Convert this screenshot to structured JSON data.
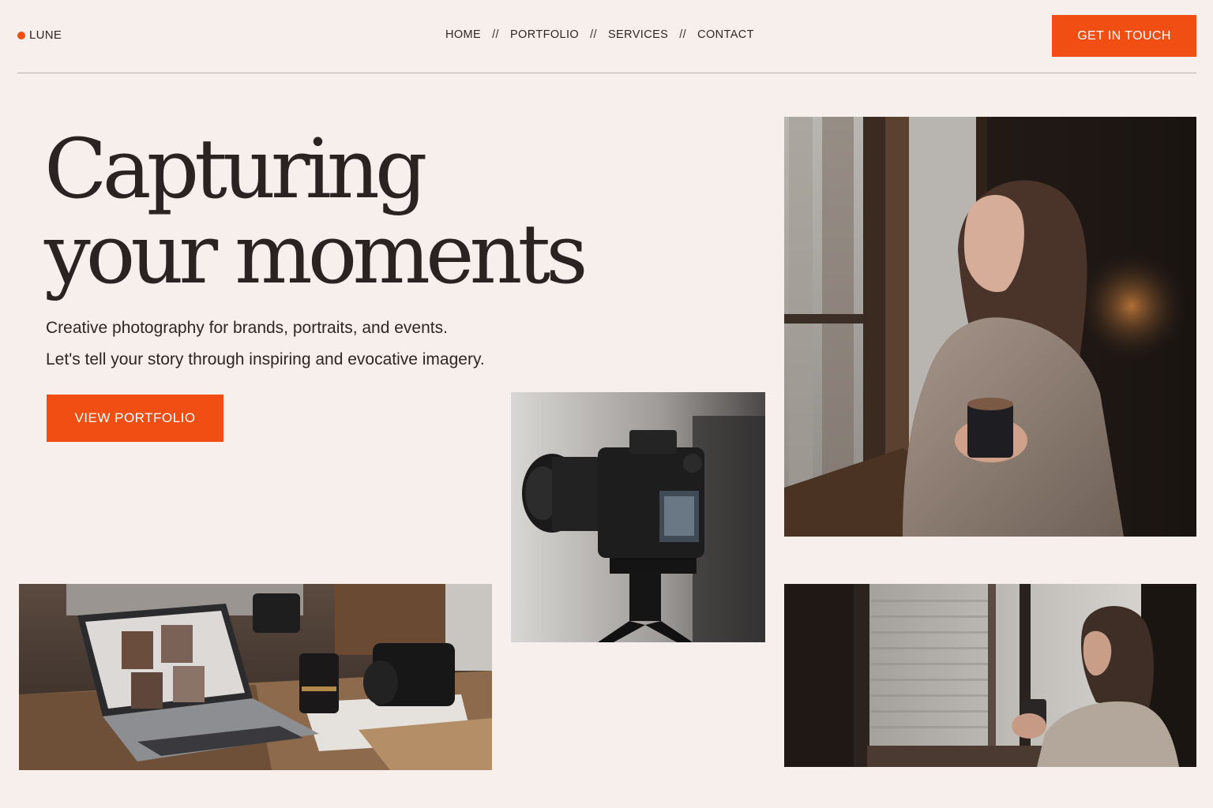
{
  "header": {
    "brand": "LUNE",
    "nav": [
      {
        "label": "HOME"
      },
      {
        "label": "PORTFOLIO"
      },
      {
        "label": "SERVICES"
      },
      {
        "label": "CONTACT"
      }
    ],
    "nav_separator": "//",
    "cta_label": "GET IN TOUCH"
  },
  "hero": {
    "headline_line1": "Capturing",
    "headline_line2": "your moments",
    "subline1": "Creative photography for brands, portraits, and events.",
    "subline2": "Let's tell your story through inspiring and evocative imagery.",
    "cta_label": "VIEW PORTFOLIO"
  },
  "colors": {
    "accent": "#f04e12",
    "background": "#f7efec",
    "text": "#2b2321"
  },
  "icons": {
    "brand_dot": "brand-dot-icon"
  }
}
